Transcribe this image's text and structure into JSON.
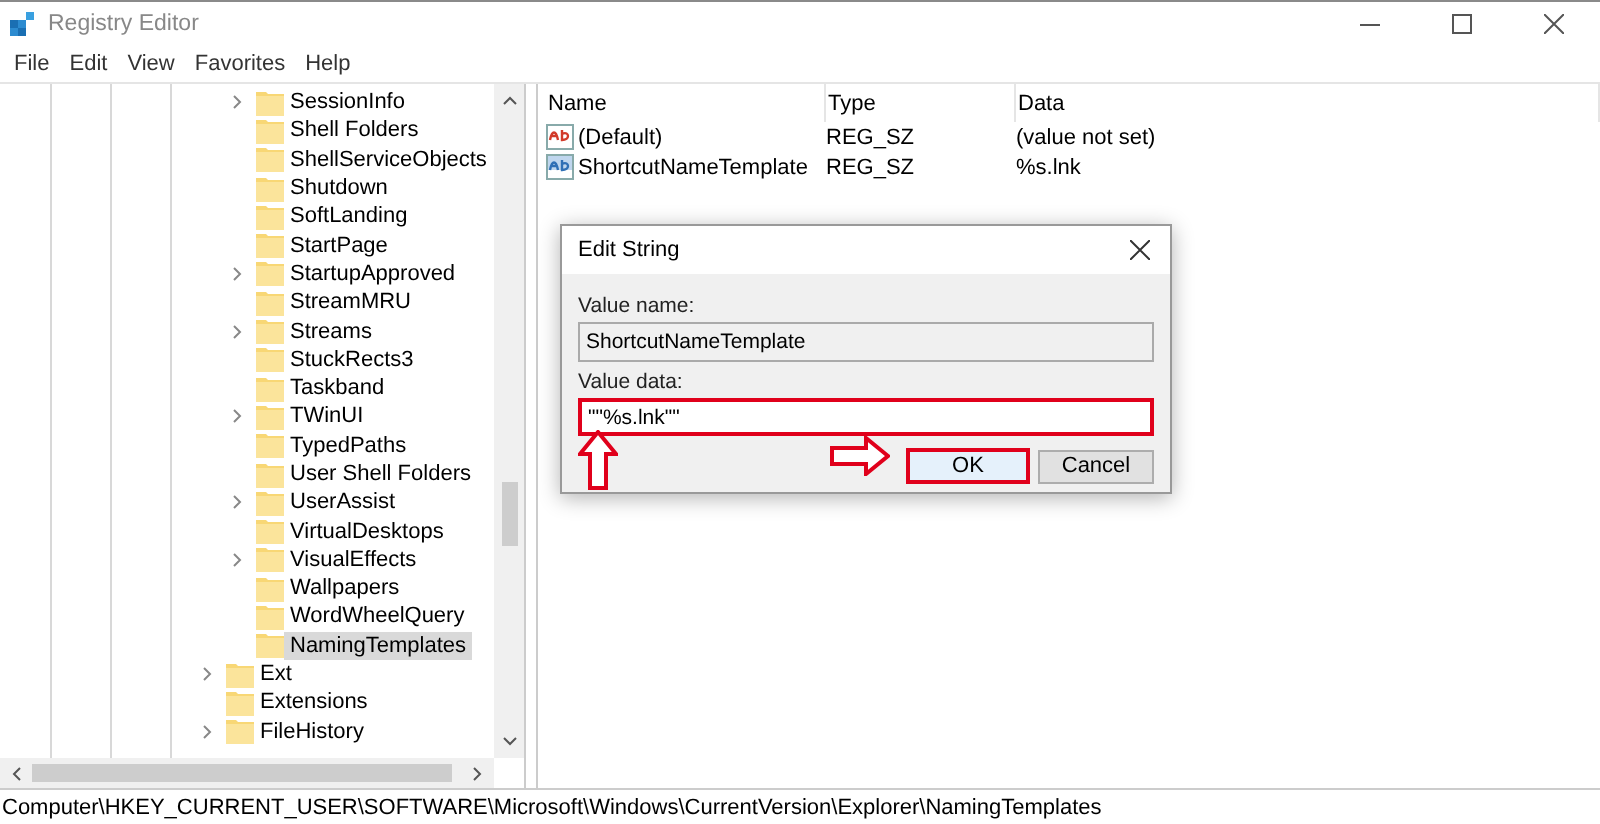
{
  "window": {
    "title": "Registry Editor"
  },
  "menu": [
    {
      "label": "File"
    },
    {
      "label": "Edit"
    },
    {
      "label": "View"
    },
    {
      "label": "Favorites"
    },
    {
      "label": "Help"
    }
  ],
  "tree": {
    "items": [
      {
        "children": [
          {
            "label": "SessionInfo",
            "expandable": true,
            "selected": false
          },
          {
            "label": "Shell Folders",
            "expandable": false,
            "selected": false
          },
          {
            "label": "ShellServiceObjects",
            "expandable": false,
            "selected": false
          },
          {
            "label": "Shutdown",
            "expandable": false,
            "selected": false
          },
          {
            "label": "SoftLanding",
            "expandable": false,
            "selected": false
          },
          {
            "label": "StartPage",
            "expandable": false,
            "selected": false
          },
          {
            "label": "StartupApproved",
            "expandable": true,
            "selected": false
          },
          {
            "label": "StreamMRU",
            "expandable": false,
            "selected": false
          },
          {
            "label": "Streams",
            "expandable": true,
            "selected": false
          },
          {
            "label": "StuckRects3",
            "expandable": false,
            "selected": false
          },
          {
            "label": "Taskband",
            "expandable": false,
            "selected": false
          },
          {
            "label": "TWinUI",
            "expandable": true,
            "selected": false
          },
          {
            "label": "TypedPaths",
            "expandable": false,
            "selected": false
          },
          {
            "label": "User Shell Folders",
            "expandable": false,
            "selected": false
          },
          {
            "label": "UserAssist",
            "expandable": true,
            "selected": false
          },
          {
            "label": "VirtualDesktops",
            "expandable": false,
            "selected": false
          },
          {
            "label": "VisualEffects",
            "expandable": true,
            "selected": false
          },
          {
            "label": "Wallpapers",
            "expandable": false,
            "selected": false
          },
          {
            "label": "WordWheelQuery",
            "expandable": false,
            "selected": false
          },
          {
            "label": "NamingTemplates",
            "expandable": false,
            "selected": true
          }
        ]
      },
      {
        "label": "Ext",
        "expandable": true,
        "selected": false
      },
      {
        "label": "Extensions",
        "expandable": false,
        "selected": false
      },
      {
        "label": "FileHistory",
        "expandable": true,
        "selected": false
      }
    ]
  },
  "values": {
    "columns": [
      "Name",
      "Type",
      "Data"
    ],
    "rows": [
      {
        "kind": "default",
        "name": "(Default)",
        "type": "REG_SZ",
        "data": "(value not set)"
      },
      {
        "kind": "string",
        "name": "ShortcutNameTemplate",
        "type": "REG_SZ",
        "data": "%s.lnk"
      }
    ]
  },
  "dialog": {
    "title": "Edit String",
    "name_label": "Value name:",
    "name_value": "ShortcutNameTemplate",
    "data_label": "Value data:",
    "data_value": "\"\"%s.lnk\"\"",
    "data_highlighted": true,
    "buttons": [
      {
        "label": "OK",
        "highlighted": true
      },
      {
        "label": "Cancel",
        "highlighted": false
      }
    ]
  },
  "status_bar": "Computer\\HKEY_CURRENT_USER\\SOFTWARE\\Microsoft\\Windows\\CurrentVersion\\Explorer\\NamingTemplates"
}
